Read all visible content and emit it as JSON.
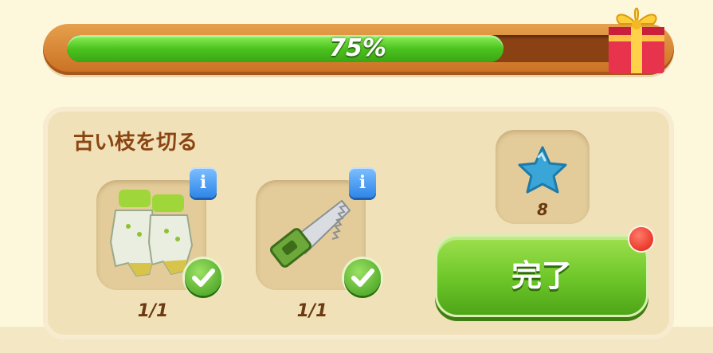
{
  "progress": {
    "percent_label": "75%",
    "fraction": 0.75,
    "fill_color": "#4cc41f",
    "reward_icon": "gift-box-icon"
  },
  "quest": {
    "title": "古い枝を切る",
    "items": [
      {
        "icon": "gardening-gloves-icon",
        "count": "1/1",
        "info_icon": "info-icon",
        "status_icon": "checkmark-icon"
      },
      {
        "icon": "hand-saw-icon",
        "count": "1/1",
        "info_icon": "info-icon",
        "status_icon": "checkmark-icon"
      }
    ],
    "reward": {
      "icon": "blue-star-icon",
      "value": "8"
    },
    "complete_button": {
      "label": "完了"
    }
  },
  "colors": {
    "accent_green": "#6cc628",
    "frame_orange": "#c96f22",
    "title_brown": "#8b4513",
    "notification_red": "#e21d0e",
    "info_blue": "#2e86e8"
  }
}
